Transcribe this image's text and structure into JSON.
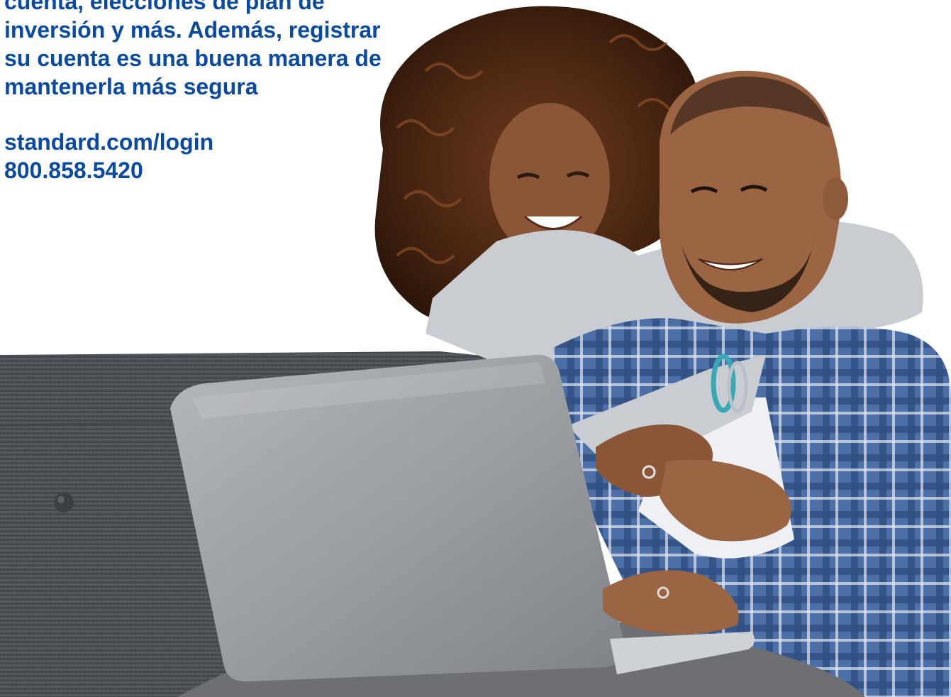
{
  "promo": {
    "lines": [
      "cuenta, elecciones de plan de",
      "inversión y más. Además, registrar",
      "su cuenta es una buena manera de",
      "mantenerla más segura"
    ],
    "website": "standard.com/login",
    "phone": "800.858.5420"
  },
  "photo": {
    "subject": "couple-using-laptop-on-sofa"
  },
  "colors": {
    "brand_text": "#0a4aa3",
    "background": "#ffffff",
    "sofa": "#4e5257",
    "laptop": "#9fa2a6"
  }
}
